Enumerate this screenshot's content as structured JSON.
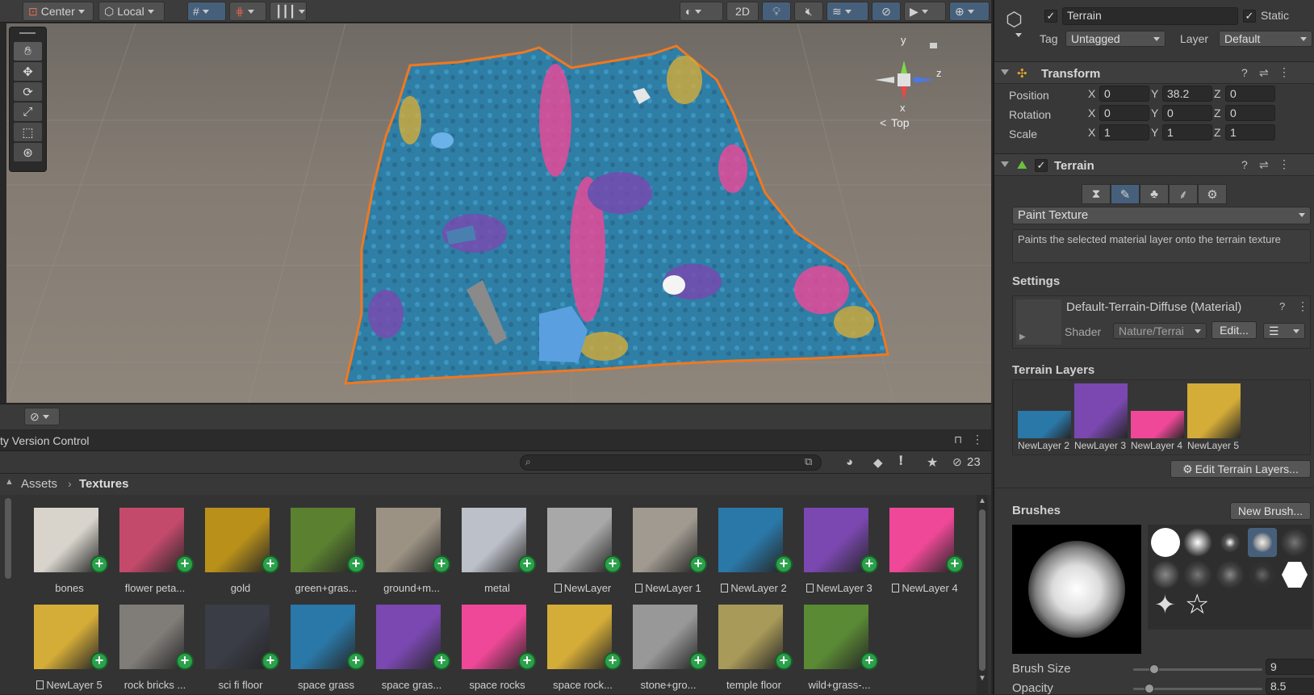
{
  "toolbar": {
    "pivot_label": "Center",
    "space_label": "Local",
    "view2d_label": "2D"
  },
  "scene": {
    "gizmo_axis_y": "y",
    "gizmo_axis_z": "z",
    "gizmo_axis_x": "x",
    "view_label": "Top"
  },
  "project": {
    "tab_label": "ty Version Control",
    "search_placeholder": "",
    "hidden_count": "23",
    "breadcrumb_root": "Assets",
    "breadcrumb_current": "Textures",
    "assets": [
      {
        "label": "bones",
        "doc": false,
        "color": "#d8d4cc"
      },
      {
        "label": "flower peta...",
        "doc": false,
        "color": "#c44a6c"
      },
      {
        "label": "gold",
        "doc": false,
        "color": "#b8901a"
      },
      {
        "label": "green+gras...",
        "doc": false,
        "color": "#5a8030"
      },
      {
        "label": "ground+m...",
        "doc": false,
        "color": "#9c9283"
      },
      {
        "label": "metal",
        "doc": false,
        "color": "#bcc0c8"
      },
      {
        "label": "NewLayer",
        "doc": true,
        "color": "#a8a8a8"
      },
      {
        "label": "NewLayer 1",
        "doc": true,
        "color": "#a09a90"
      },
      {
        "label": "NewLayer 2",
        "doc": true,
        "color": "#2a78a8"
      },
      {
        "label": "NewLayer 3",
        "doc": true,
        "color": "#7a48b0"
      },
      {
        "label": "NewLayer 4",
        "doc": true,
        "color": "#f04898"
      },
      {
        "label": "NewLayer 5",
        "doc": true,
        "color": "#d4ac38"
      },
      {
        "label": "rock bricks ...",
        "doc": false,
        "color": "#807c78"
      },
      {
        "label": "sci fi floor",
        "doc": false,
        "color": "#3a3c46"
      },
      {
        "label": "space grass",
        "doc": false,
        "color": "#2a78a8"
      },
      {
        "label": "space gras...",
        "doc": false,
        "color": "#7a48b0"
      },
      {
        "label": "space rocks",
        "doc": false,
        "color": "#f04898"
      },
      {
        "label": "space rock...",
        "doc": false,
        "color": "#d4ac38"
      },
      {
        "label": "stone+gro...",
        "doc": false,
        "color": "#989898"
      },
      {
        "label": "temple floor",
        "doc": false,
        "color": "#a89a58"
      },
      {
        "label": "wild+grass-...",
        "doc": false,
        "color": "#5a8a34"
      }
    ]
  },
  "inspector": {
    "object_name": "Terrain",
    "static_label": "Static",
    "tag_label": "Tag",
    "tag_value": "Untagged",
    "layer_label": "Layer",
    "layer_value": "Default",
    "transform": {
      "title": "Transform",
      "position_label": "Position",
      "rotation_label": "Rotation",
      "scale_label": "Scale",
      "x_label": "X",
      "y_label": "Y",
      "z_label": "Z",
      "position": {
        "x": "0",
        "y": "38.2",
        "z": "0"
      },
      "rotation": {
        "x": "0",
        "y": "0",
        "z": "0"
      },
      "scale": {
        "x": "1",
        "y": "1",
        "z": "1"
      }
    },
    "terrain": {
      "title": "Terrain",
      "mode_value": "Paint Texture",
      "mode_description": "Paints the selected material layer onto the terrain texture",
      "settings_label": "Settings",
      "material_name": "Default-Terrain-Diffuse (Material)",
      "shader_label": "Shader",
      "shader_value": "Nature/Terrai",
      "edit_label": "Edit...",
      "terrain_layers_label": "Terrain Layers",
      "layers": [
        {
          "label": "NewLayer 2",
          "color": "#2a78a8"
        },
        {
          "label": "NewLayer 3",
          "color": "#7a48b0"
        },
        {
          "label": "NewLayer 4",
          "color": "#f04898"
        },
        {
          "label": "NewLayer 5",
          "color": "#d4ac38"
        }
      ],
      "edit_layers_label": "Edit Terrain Layers...",
      "brushes_label": "Brushes",
      "new_brush_label": "New Brush...",
      "brush_size_label": "Brush Size",
      "brush_size_value": "9",
      "opacity_label": "Opacity",
      "opacity_value": "8.5"
    }
  },
  "colors": {
    "accent_blue": "#46607c",
    "selection_outline": "#f07820",
    "add_badge": "#2aa14a"
  }
}
